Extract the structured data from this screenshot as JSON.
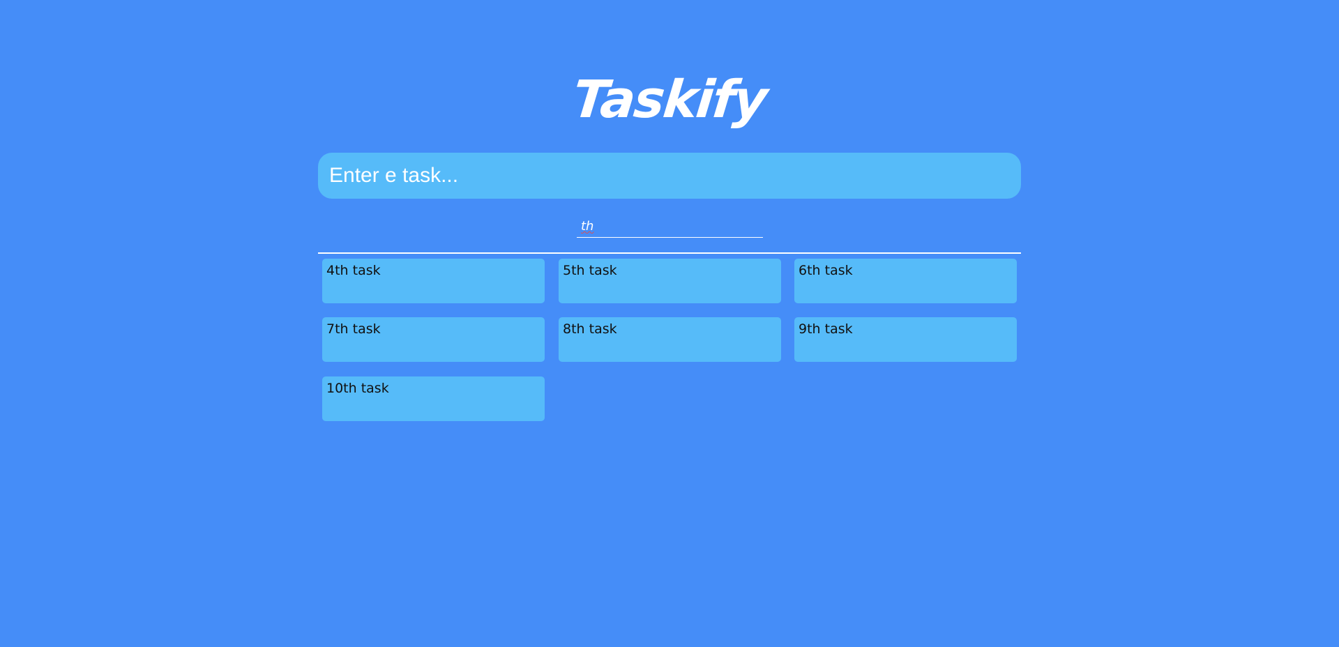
{
  "app": {
    "title": "Taskify"
  },
  "new_task": {
    "placeholder": "Enter e task..."
  },
  "filter": {
    "value": "th"
  },
  "tasks": [
    {
      "label": "4th task"
    },
    {
      "label": "5th task"
    },
    {
      "label": "6th task"
    },
    {
      "label": "7th task"
    },
    {
      "label": "8th task"
    },
    {
      "label": "9th task"
    },
    {
      "label": "10th task"
    }
  ],
  "colors": {
    "background": "#458DF8",
    "card": "#56BBF9",
    "text_light": "#FFFFFF",
    "text_dark": "#111111"
  }
}
